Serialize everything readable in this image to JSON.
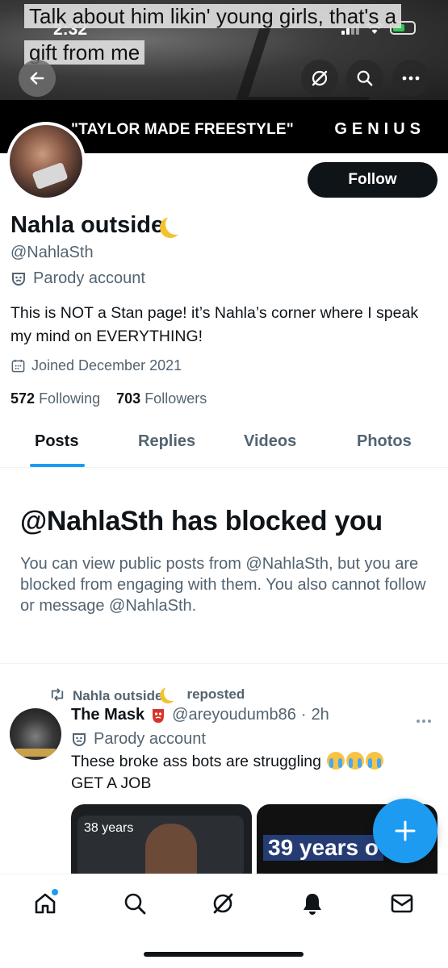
{
  "overlay_caption": {
    "line1": "Talk about him likin' young girls, that's a",
    "line2": "gift from me"
  },
  "status_bar": {
    "time": "2:32"
  },
  "banner": {
    "song_text": "\"TAYLOR MADE FREESTYLE\"",
    "brand_text": "GENIUS"
  },
  "profile": {
    "display_name": "Nahla outside",
    "handle": "@NahlaSth",
    "parody_label": "Parody account",
    "bio": "This is NOT a Stan page! it’s Nahla’s corner where I speak my mind on EVERYTHING!",
    "joined": "Joined December 2021",
    "following_count": "572",
    "following_label": "Following",
    "followers_count": "703",
    "followers_label": "Followers",
    "follow_button": "Follow"
  },
  "tabs": [
    {
      "label": "Posts"
    },
    {
      "label": "Replies"
    },
    {
      "label": "Videos"
    },
    {
      "label": "Photos"
    }
  ],
  "blocked": {
    "title": "@NahlaSth has blocked you",
    "body": "You can view public posts from @NahlaSth, but you are blocked from engaging with them. You also cannot follow or message @NahlaSth."
  },
  "post": {
    "repost_name": "Nahla outside",
    "repost_label": "reposted",
    "author_name": "The Mask",
    "author_handle": "@areyoudumb86",
    "separator": "·",
    "time": "2h",
    "parody_label": "Parody account",
    "text_line1": "These broke ass bots are struggling",
    "text_line2": "GET A JOB",
    "media": [
      {
        "caption": "38 years"
      },
      {
        "caption": "39 years o"
      }
    ]
  },
  "bottom_nav": [
    {
      "icon": "home-icon"
    },
    {
      "icon": "search-icon"
    },
    {
      "icon": "grok-icon"
    },
    {
      "icon": "bell-icon"
    },
    {
      "icon": "mail-icon"
    }
  ],
  "colors": {
    "accent": "#1d9bf0",
    "text_primary": "#0f1419",
    "text_secondary": "#536471"
  }
}
